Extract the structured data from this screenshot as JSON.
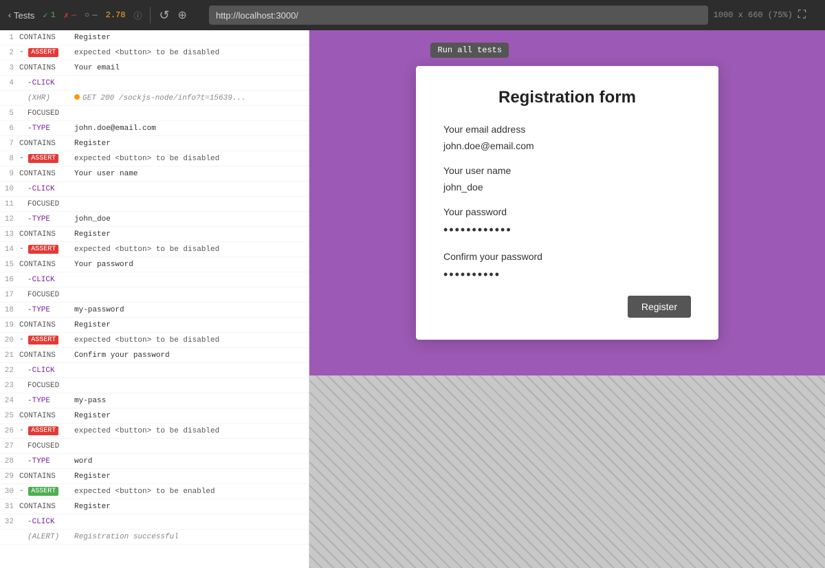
{
  "toolbar": {
    "tests_label": "Tests",
    "pass_count": "1",
    "fail_count": "—",
    "pending_count": "—",
    "time": "2.78",
    "url": "http://localhost:3000/",
    "viewport": "1000 x 660 (75%)",
    "run_all_tooltip": "Run all tests"
  },
  "log_lines": [
    {
      "num": "1",
      "type": "CONTAINS",
      "content": "Register",
      "badge": null
    },
    {
      "num": "2",
      "type": "- ASSERT",
      "content": "expected <button> to be disabled",
      "badge": "fail"
    },
    {
      "num": "3",
      "type": "CONTAINS",
      "content": "Your email",
      "badge": null
    },
    {
      "num": "4",
      "type": "-CLICK",
      "content": "",
      "badge": null
    },
    {
      "num": "4b",
      "type": "(XHR)",
      "content": "GET 200 /sockjs-node/info?t=15639...",
      "badge": null,
      "xhr": true
    },
    {
      "num": "5",
      "type": "FOCUSED",
      "content": "",
      "badge": null
    },
    {
      "num": "6",
      "type": "-TYPE",
      "content": "john.doe@email.com",
      "badge": null
    },
    {
      "num": "7",
      "type": "CONTAINS",
      "content": "Register",
      "badge": null
    },
    {
      "num": "8",
      "type": "- ASSERT",
      "content": "expected <button> to be disabled",
      "badge": "fail"
    },
    {
      "num": "9",
      "type": "CONTAINS",
      "content": "Your user name",
      "badge": null
    },
    {
      "num": "10",
      "type": "-CLICK",
      "content": "",
      "badge": null
    },
    {
      "num": "11",
      "type": "FOCUSED",
      "content": "",
      "badge": null
    },
    {
      "num": "12",
      "type": "-TYPE",
      "content": "john_doe",
      "badge": null
    },
    {
      "num": "13",
      "type": "CONTAINS",
      "content": "Register",
      "badge": null
    },
    {
      "num": "14",
      "type": "- ASSERT",
      "content": "expected <button> to be disabled",
      "badge": "fail"
    },
    {
      "num": "15",
      "type": "CONTAINS",
      "content": "Your password",
      "badge": null
    },
    {
      "num": "16",
      "type": "-CLICK",
      "content": "",
      "badge": null
    },
    {
      "num": "17",
      "type": "FOCUSED",
      "content": "",
      "badge": null
    },
    {
      "num": "18",
      "type": "-TYPE",
      "content": "my-password",
      "badge": null
    },
    {
      "num": "19",
      "type": "CONTAINS",
      "content": "Register",
      "badge": null
    },
    {
      "num": "20",
      "type": "- ASSERT",
      "content": "expected <button> to be disabled",
      "badge": "fail"
    },
    {
      "num": "21",
      "type": "CONTAINS",
      "content": "Confirm your password",
      "badge": null
    },
    {
      "num": "22",
      "type": "-CLICK",
      "content": "",
      "badge": null
    },
    {
      "num": "23",
      "type": "FOCUSED",
      "content": "",
      "badge": null
    },
    {
      "num": "24",
      "type": "-TYPE",
      "content": "my-pass",
      "badge": null
    },
    {
      "num": "25",
      "type": "CONTAINS",
      "content": "Register",
      "badge": null
    },
    {
      "num": "26",
      "type": "- ASSERT",
      "content": "expected <button> to be disabled",
      "badge": "fail"
    },
    {
      "num": "27",
      "type": "FOCUSED",
      "content": "",
      "badge": null
    },
    {
      "num": "28",
      "type": "-TYPE",
      "content": "word",
      "badge": null
    },
    {
      "num": "29",
      "type": "CONTAINS",
      "content": "Register",
      "badge": null
    },
    {
      "num": "30",
      "type": "- ASSERT",
      "content": "expected <button> to be enabled",
      "badge": "pass"
    },
    {
      "num": "31",
      "type": "CONTAINS",
      "content": "Register",
      "badge": null
    },
    {
      "num": "32",
      "type": "-CLICK",
      "content": "",
      "badge": null
    },
    {
      "num": "32b",
      "type": "(ALERT)",
      "content": "Registration successful",
      "badge": null,
      "alert": true
    }
  ],
  "form": {
    "title": "Registration form",
    "email_label": "Your email address",
    "email_value": "john.doe@email.com",
    "username_label": "Your user name",
    "username_value": "john_doe",
    "password_label": "Your password",
    "password_dots": "••••••••••••",
    "confirm_label": "Confirm your password",
    "confirm_dots": "••••••••••",
    "register_btn": "Register"
  }
}
